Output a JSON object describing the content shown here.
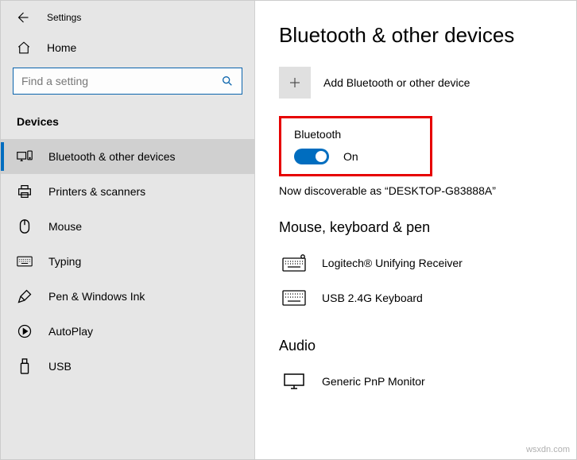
{
  "app": {
    "title": "Settings"
  },
  "sidebar": {
    "home_label": "Home",
    "search_placeholder": "Find a setting",
    "section_header": "Devices",
    "items": [
      {
        "label": "Bluetooth & other devices"
      },
      {
        "label": "Printers & scanners"
      },
      {
        "label": "Mouse"
      },
      {
        "label": "Typing"
      },
      {
        "label": "Pen & Windows Ink"
      },
      {
        "label": "AutoPlay"
      },
      {
        "label": "USB"
      }
    ]
  },
  "main": {
    "page_title": "Bluetooth & other devices",
    "add_label": "Add Bluetooth or other device",
    "bluetooth": {
      "label": "Bluetooth",
      "state": "On"
    },
    "discover_text": "Now discoverable as “DESKTOP-G83888A”",
    "section_mouse": "Mouse, keyboard & pen",
    "devices": [
      {
        "label": "Logitech® Unifying Receiver"
      },
      {
        "label": "USB 2.4G Keyboard"
      }
    ],
    "section_audio": "Audio",
    "audio_devices": [
      {
        "label": "Generic PnP Monitor"
      }
    ]
  },
  "watermark": "wsxdn.com"
}
